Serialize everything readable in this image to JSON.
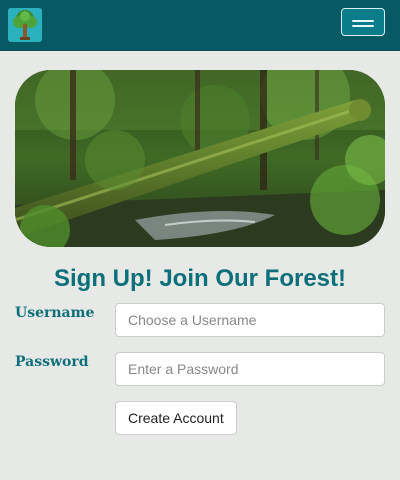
{
  "navbar": {
    "logo_icon": "tree-icon",
    "menu_icon": "hamburger-menu-icon",
    "background_color": "#075a63"
  },
  "hero": {
    "image_description_icon": "forest-log-stream-image"
  },
  "signup": {
    "title": "Sign Up! Join Our Forest!",
    "username_label": "Username",
    "username_placeholder": "Choose a Username",
    "password_label": "Password",
    "password_placeholder": "Enter a Password",
    "submit_label": "Create Account"
  },
  "colors": {
    "accent": "#0d6f7a",
    "page_background": "#e6e9e6"
  }
}
